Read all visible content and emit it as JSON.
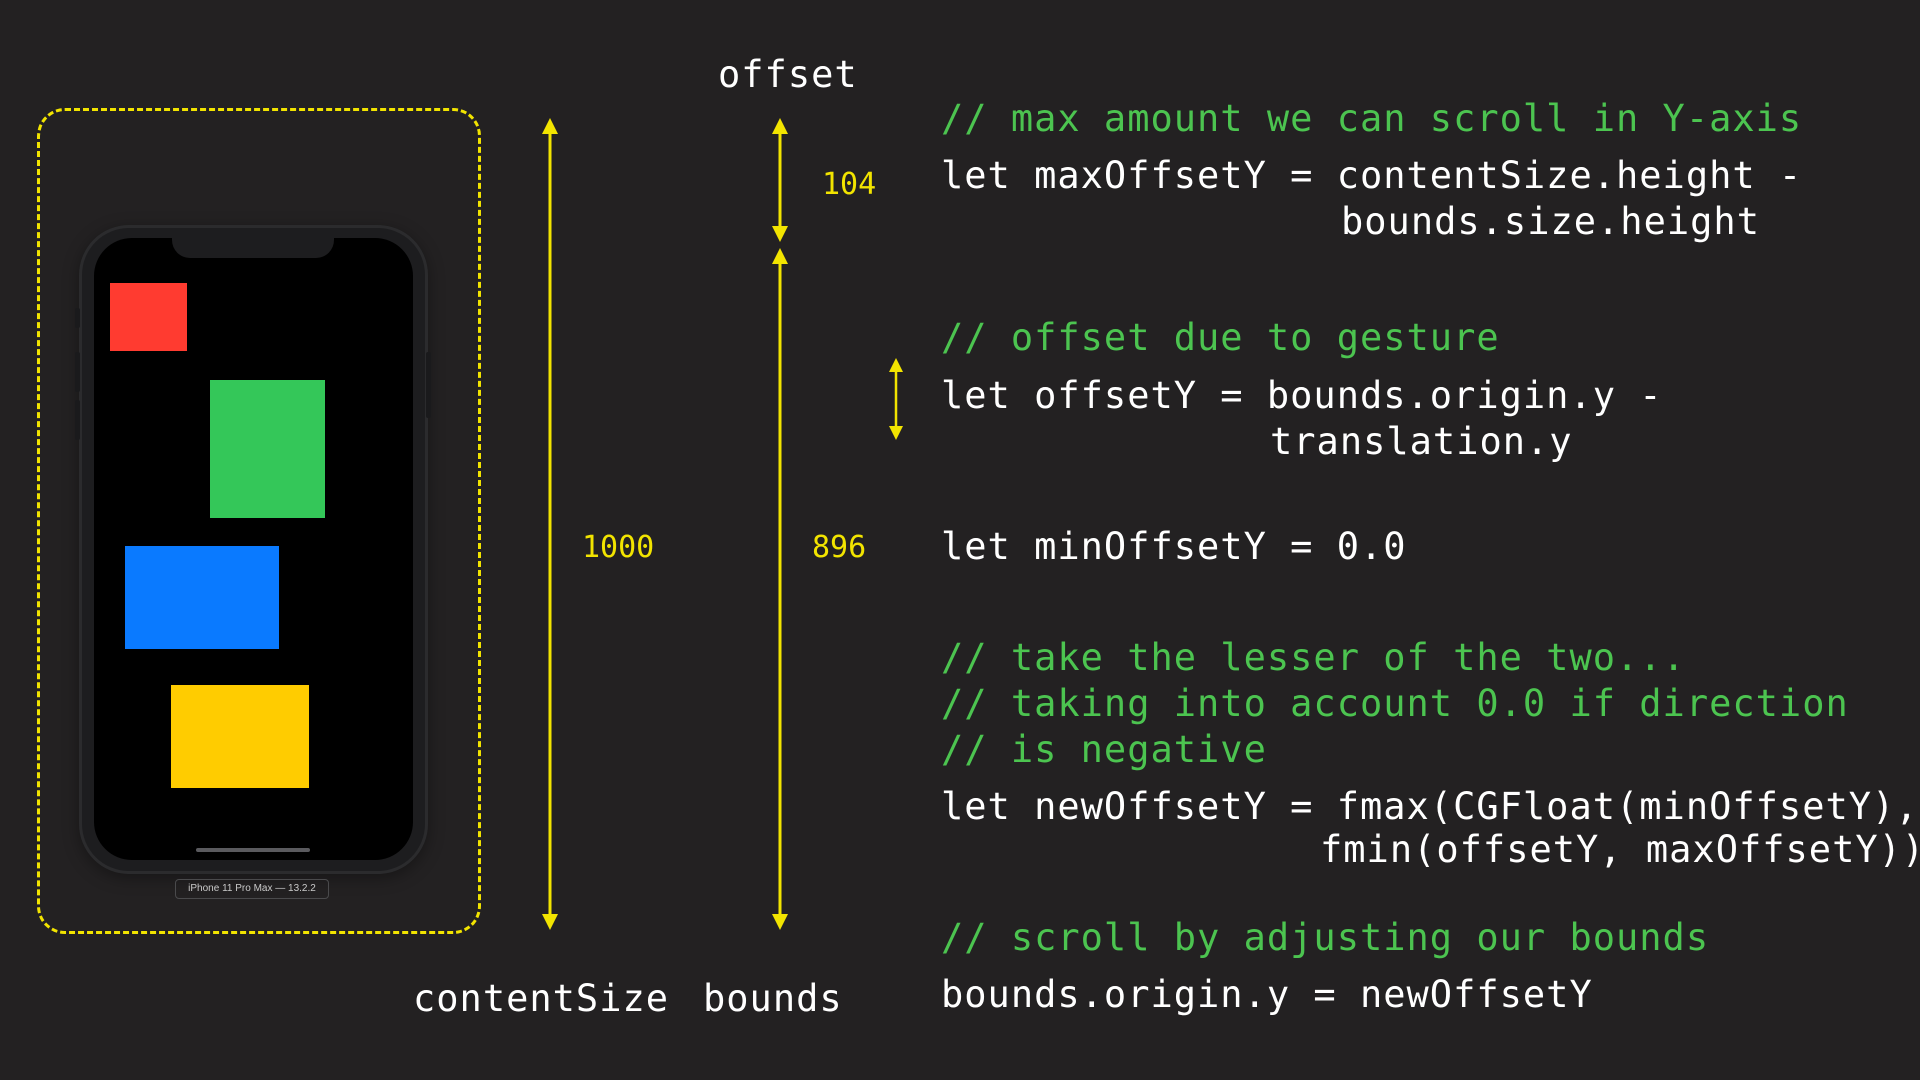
{
  "colors": {
    "background": "#232122",
    "accent_yellow": "#f2e400",
    "comment_green": "#4cc450",
    "code_white": "#ffffff",
    "box_red": "#ff3b30",
    "box_green": "#34c759",
    "box_blue": "#0a7aff",
    "box_yellow": "#ffcc00"
  },
  "labels": {
    "offset": "offset",
    "content_size": "contentSize",
    "bounds": "bounds",
    "dimension_1000": "1000",
    "dimension_104": "104",
    "dimension_896": "896"
  },
  "device": {
    "label": "iPhone 11 Pro Max — 13.2.2"
  },
  "code": {
    "comment_max": "// max amount we can scroll in Y-axis",
    "max_line1": "let maxOffsetY = contentSize.height -",
    "max_line2": "bounds.size.height",
    "comment_gesture": "// offset due to gesture",
    "offset_line1": "let offsetY = bounds.origin.y -",
    "offset_line2": "translation.y",
    "min_line": "let minOffsetY = 0.0",
    "comment_lesser_1": "// take the lesser of the two...",
    "comment_lesser_2": "// taking into account 0.0 if direction",
    "comment_lesser_3": "// is negative",
    "new_line1": "let newOffsetY = fmax(CGFloat(minOffsetY),",
    "new_line2": "fmin(offsetY, maxOffsetY))",
    "comment_scroll": "// scroll by adjusting our bounds",
    "scroll_line": "bounds.origin.y = newOffsetY"
  }
}
